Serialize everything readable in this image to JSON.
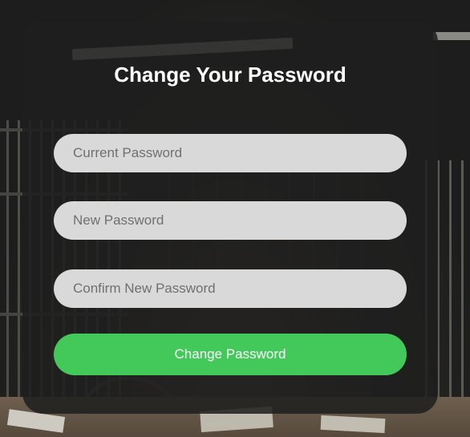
{
  "form": {
    "title": "Change Your Password",
    "current_password": {
      "placeholder": "Current Password",
      "value": ""
    },
    "new_password": {
      "placeholder": "New Password",
      "value": ""
    },
    "confirm_password": {
      "placeholder": "Confirm New Password",
      "value": ""
    },
    "submit_label": "Change Password"
  },
  "colors": {
    "accent": "#43c85a",
    "card_background": "#1e1e1e",
    "input_background": "#d9d9d9",
    "title_text": "#ffffff"
  }
}
